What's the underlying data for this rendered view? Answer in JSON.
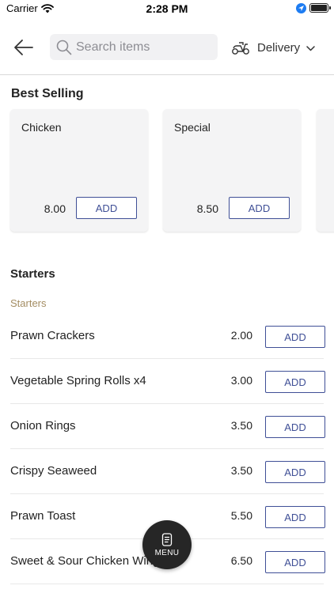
{
  "status_bar": {
    "carrier": "Carrier",
    "time": "2:28 PM",
    "icons": [
      "wifi-icon",
      "location-icon",
      "battery-icon"
    ]
  },
  "header": {
    "back_icon": "arrow-left-icon",
    "search": {
      "placeholder": "Search items",
      "value": ""
    },
    "order_type": {
      "label": "Delivery",
      "icon": "scooter-icon",
      "dropdown_icon": "chevron-down-icon"
    }
  },
  "best_selling": {
    "title": "Best Selling",
    "items": [
      {
        "name": "Chicken",
        "price": "8.00",
        "add_label": "ADD"
      },
      {
        "name": "Special",
        "price": "8.50",
        "add_label": "ADD"
      }
    ]
  },
  "starters": {
    "title": "Starters",
    "subcategory": "Starters",
    "items": [
      {
        "name": "Prawn Crackers",
        "price": "2.00",
        "add_label": "ADD"
      },
      {
        "name": "Vegetable Spring Rolls x4",
        "price": "3.00",
        "add_label": "ADD"
      },
      {
        "name": "Onion Rings",
        "price": "3.50",
        "add_label": "ADD"
      },
      {
        "name": "Crispy Seaweed",
        "price": "3.50",
        "add_label": "ADD"
      },
      {
        "name": "Prawn Toast",
        "price": "5.50",
        "add_label": "ADD"
      },
      {
        "name": "Sweet & Sour Chicken Wings",
        "price": "6.50",
        "add_label": "ADD"
      }
    ]
  },
  "menu_button": {
    "label": "MENU",
    "icon": "menu-card-icon"
  },
  "colors": {
    "accent": "#3f4f96",
    "subcategory": "#a48d63",
    "fab": "#262626",
    "card_bg": "#f4f4f5"
  }
}
